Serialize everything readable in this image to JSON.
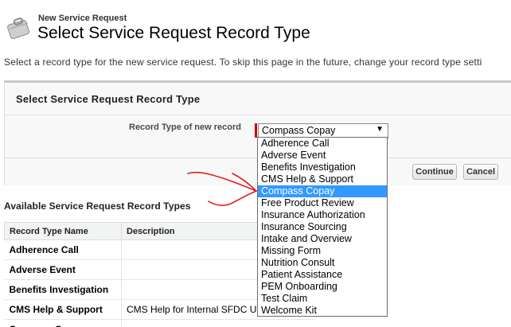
{
  "header": {
    "subtitle": "New Service Request",
    "title": "Select Service Request Record Type",
    "icon": "briefcase-icon"
  },
  "intro_text": "Select a record type for the new service request.  To skip this page in the future, change your record type setti",
  "panel": {
    "title": "Select Service Request Record Type",
    "field_label": "Record Type of new record",
    "selected_value": "Compass Copay",
    "arrow": "▼",
    "continue_label": "Continue",
    "cancel_label": "Cancel"
  },
  "dropdown_options": [
    "Adherence Call",
    "Adverse Event",
    "Benefits Investigation",
    "CMS Help & Support",
    "Compass Copay",
    "Free Product Review",
    "Insurance Authorization",
    "Insurance Sourcing",
    "Intake and Overview",
    "Missing Form",
    "Nutrition Consult",
    "Patient Assistance",
    "PEM Onboarding",
    "Test Claim",
    "Welcome Kit"
  ],
  "highlighted_option_index": 4,
  "available": {
    "title": "Available Service Request Record Types",
    "columns": [
      "Record Type Name",
      "Description"
    ],
    "rows": [
      {
        "name": "Adherence Call",
        "description": ""
      },
      {
        "name": "Adverse Event",
        "description": ""
      },
      {
        "name": "Benefits Investigation",
        "description": ""
      },
      {
        "name": "CMS Help & Support",
        "description": "CMS Help for Internal SFDC U"
      },
      {
        "name": "Compass Copay",
        "description": ""
      }
    ]
  },
  "colors": {
    "required": "#cc0000",
    "highlight": "#3399ff",
    "annotation": "#e21b1b"
  }
}
